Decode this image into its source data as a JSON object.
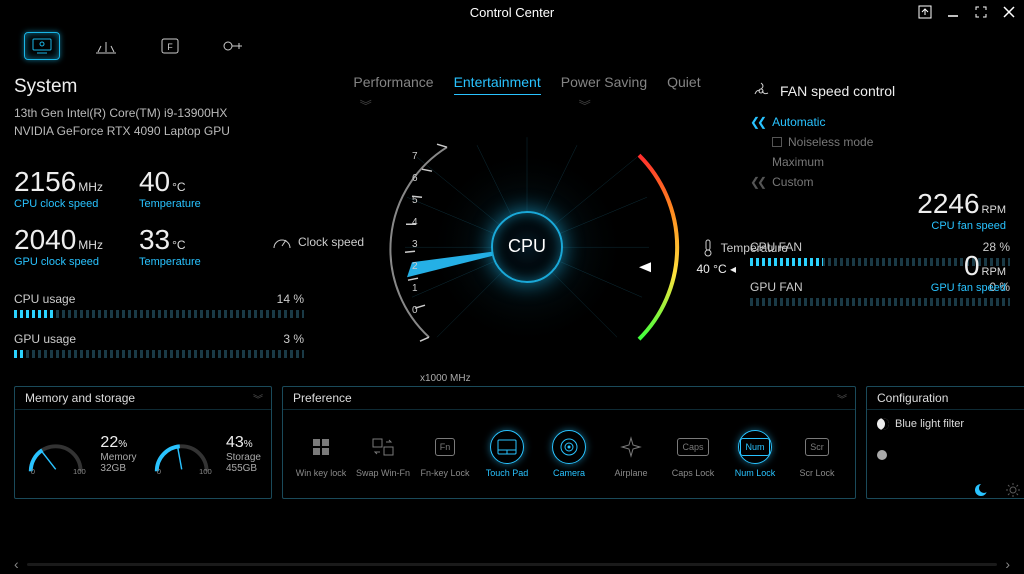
{
  "window_title": "Control Center",
  "system": {
    "heading": "System",
    "cpu_name": "13th Gen Intel(R) Core(TM) i9-13900HX",
    "gpu_name": "NVIDIA GeForce RTX 4090 Laptop GPU"
  },
  "modes": [
    "Performance",
    "Entertainment",
    "Power Saving",
    "Quiet"
  ],
  "mode_active_index": 1,
  "stats": {
    "cpu_clock_value": "2156",
    "cpu_clock_unit": "MHz",
    "cpu_clock_label": "CPU clock speed",
    "cpu_temp_value": "40",
    "cpu_temp_unit": "°C",
    "cpu_temp_label": "Temperature",
    "gpu_clock_value": "2040",
    "gpu_clock_unit": "MHz",
    "gpu_clock_label": "GPU clock speed",
    "gpu_temp_value": "33",
    "gpu_temp_unit": "°C",
    "gpu_temp_label": "Temperature"
  },
  "usage": {
    "cpu_label": "CPU usage",
    "cpu_pct": "14  %",
    "cpu_fill": 14,
    "gpu_label": "GPU usage",
    "gpu_pct": "3  %",
    "gpu_fill": 3
  },
  "gauge": {
    "center_label": "CPU",
    "clock_side": "Clock speed",
    "temp_side": "Temperature",
    "temp_readout": "40 °C",
    "x_unit": "x1000 MHz",
    "ticks": [
      "7",
      "6",
      "5",
      "4",
      "3",
      "2",
      "1",
      "0"
    ]
  },
  "fan": {
    "heading": "FAN speed control",
    "opts": {
      "automatic": "Automatic",
      "noiseless": "Noiseless mode",
      "maximum": "Maximum",
      "custom": "Custom"
    },
    "cpu_fan_value": "2246",
    "cpu_fan_unit": "RPM",
    "cpu_fan_label": "CPU fan speed",
    "gpu_fan_value": "0",
    "gpu_fan_unit": "RPM",
    "gpu_fan_label": "GPU fan speed",
    "cpu_fan_usage_label": "CPU FAN",
    "cpu_fan_usage_pct": "28 %",
    "cpu_fan_fill": 28,
    "gpu_fan_usage_label": "GPU FAN",
    "gpu_fan_usage_pct": "0 %",
    "gpu_fan_fill": 0
  },
  "memory_panel": {
    "heading": "Memory and storage",
    "mem_pct": "22",
    "mem_pct_sym": "%",
    "mem_label": "Memory",
    "mem_total": "32GB",
    "sto_pct": "43",
    "sto_pct_sym": "%",
    "sto_label": "Storage",
    "sto_total": "455GB",
    "scale_low": "0",
    "scale_high": "100"
  },
  "preference": {
    "heading": "Preference",
    "items": [
      {
        "label": "Win key lock",
        "active": false,
        "icon": "win-icon"
      },
      {
        "label": "Swap Win-Fn",
        "active": false,
        "icon": "swap-icon"
      },
      {
        "label": "Fn-key Lock",
        "active": false,
        "icon": "fn-icon",
        "text": "Fn"
      },
      {
        "label": "Touch Pad",
        "active": true,
        "icon": "touchpad-icon"
      },
      {
        "label": "Camera",
        "active": true,
        "icon": "camera-icon"
      },
      {
        "label": "Airplane",
        "active": false,
        "icon": "airplane-icon"
      },
      {
        "label": "Caps Lock",
        "active": false,
        "icon": "caps-icon",
        "text": "Caps"
      },
      {
        "label": "Num Lock",
        "active": true,
        "icon": "num-icon",
        "text": "Num"
      },
      {
        "label": "Scr Lock",
        "active": false,
        "icon": "scr-icon",
        "text": "Scr"
      }
    ]
  },
  "config": {
    "heading": "Configuration",
    "blue_light_label": "Blue light filter",
    "slider_value": 0
  }
}
